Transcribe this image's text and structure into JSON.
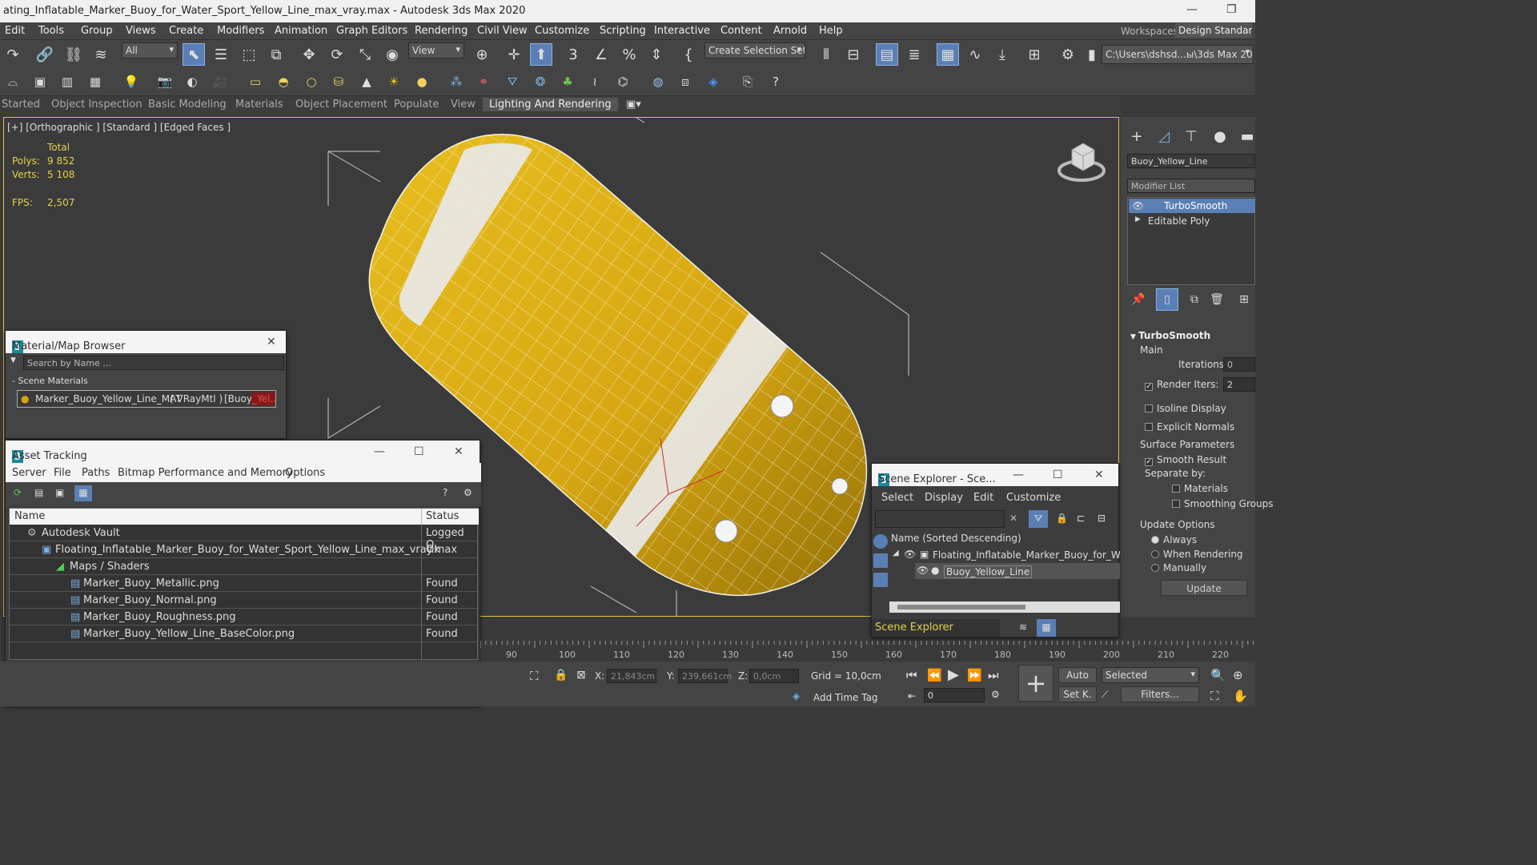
{
  "window": {
    "title": "ating_Inflatable_Marker_Buoy_for_Water_Sport_Yellow_Line_max_vray.max - Autodesk 3ds Max 2020"
  },
  "menu": [
    "Edit",
    "Tools",
    "Group",
    "Views",
    "Create",
    "Modifiers",
    "Animation",
    "Graph Editors",
    "Rendering",
    "Civil View",
    "Customize",
    "Scripting",
    "Interactive",
    "Content",
    "Arnold",
    "Help"
  ],
  "workspaces": {
    "label": "Workspaces:",
    "value": "Design Standard"
  },
  "toolbar": {
    "selection_filter": "All",
    "ref_coord": "View",
    "selection_set": "Create Selection Set",
    "project_path": "C:\\Users\\dshsd...ы\\3ds Max 2020"
  },
  "ribbon_tabs": [
    "Started",
    "Object Inspection",
    "Basic Modeling",
    "Materials",
    "Object Placement",
    "Populate",
    "View",
    "Lighting And Rendering"
  ],
  "viewport": {
    "label": "[+] [Orthographic ] [Standard ] [Edged Faces ]",
    "stats": {
      "total_label": "Total",
      "polys_label": "Polys:",
      "polys": "9 852",
      "verts_label": "Verts:",
      "verts": "5 108",
      "fps_label": "FPS:",
      "fps": "2,507"
    }
  },
  "command_panel": {
    "object_name": "Buoy_Yellow_Line",
    "modifier_list": "Modifier List",
    "stack": [
      "TurboSmooth",
      "Editable Poly"
    ],
    "rollout": "TurboSmooth",
    "main": "Main",
    "iterations_label": "Iterations:",
    "iterations": "0",
    "render_iters_label": "Render Iters:",
    "render_iters": "2",
    "isoline": "Isoline Display",
    "explicit": "Explicit Normals",
    "surface": "Surface Parameters",
    "smooth_result": "Smooth Result",
    "separate_by": "Separate by:",
    "materials": "Materials",
    "smoothing_groups": "Smoothing Groups",
    "update_options": "Update Options",
    "always": "Always",
    "when_rendering": "When Rendering",
    "manually": "Manually",
    "update_btn": "Update"
  },
  "material_browser": {
    "title": "Material/Map Browser",
    "search_placeholder": "Search by Name ...",
    "section": "- Scene Materials",
    "item_name": "Marker_Buoy_Yellow_Line_MAT",
    "item_type": "( VRayMtl )",
    "item_obj": "[Buoy_Yel..."
  },
  "asset_tracking": {
    "title": "Asset Tracking",
    "menu": [
      "Server",
      "File",
      "Paths",
      "Bitmap Performance and Memory",
      "Options"
    ],
    "col_name": "Name",
    "col_status": "Status",
    "rows": [
      {
        "name": "Autodesk Vault",
        "status": "Logged O..."
      },
      {
        "name": "Floating_Inflatable_Marker_Buoy_for_Water_Sport_Yellow_Line_max_vray.max",
        "status": "Ok"
      },
      {
        "name": "Maps / Shaders",
        "status": ""
      },
      {
        "name": "Marker_Buoy_Metallic.png",
        "status": "Found"
      },
      {
        "name": "Marker_Buoy_Normal.png",
        "status": "Found"
      },
      {
        "name": "Marker_Buoy_Roughness.png",
        "status": "Found"
      },
      {
        "name": "Marker_Buoy_Yellow_Line_BaseColor.png",
        "status": "Found"
      }
    ]
  },
  "scene_explorer": {
    "title": "Scene Explorer - Sce...",
    "menu": [
      "Select",
      "Display",
      "Edit",
      "Customize"
    ],
    "header": "Name (Sorted Descending)",
    "root": "Floating_Inflatable_Marker_Buoy_for_Water_Sp",
    "child": "Buoy_Yellow_Line",
    "footer": "Scene Explorer"
  },
  "timeline": {
    "ticks": [
      "90",
      "100",
      "110",
      "120",
      "130",
      "140",
      "150",
      "160",
      "170",
      "180",
      "190",
      "200",
      "210",
      "220"
    ]
  },
  "status": {
    "x_label": "X:",
    "x": "21,843cm",
    "y_label": "Y:",
    "y": "239,661cm",
    "z_label": "Z:",
    "z": "0,0cm",
    "grid": "Grid = 10,0cm",
    "add_time_tag": "Add Time Tag",
    "auto": "Auto",
    "set_key": "Set K.",
    "selected": "Selected",
    "filters": "Filters...",
    "frame": "0"
  },
  "colors": {
    "accent": "#5a7fb5",
    "viewport_border": "#e2c24a",
    "buoy_yellow": "#d7a712",
    "stat_yellow": "#e4d24a"
  }
}
